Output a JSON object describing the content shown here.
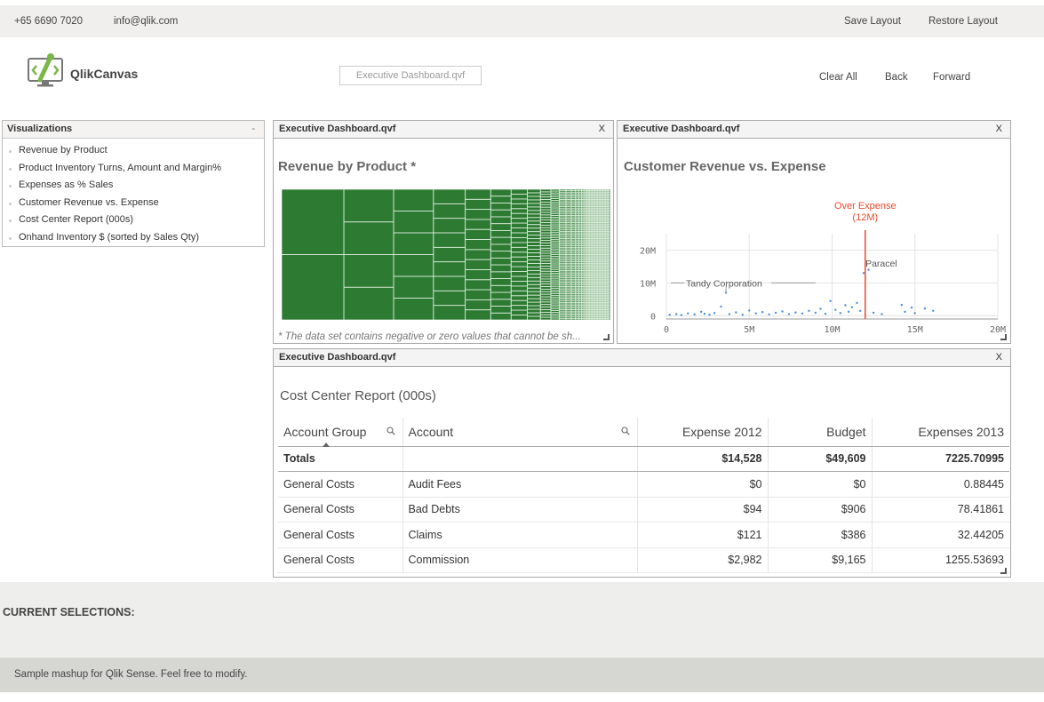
{
  "topbar": {
    "phone": "+65 6690 7020",
    "email": "info@qlik.com",
    "save_layout": "Save Layout",
    "restore_layout": "Restore Layout"
  },
  "brand": {
    "name": "QlikCanvas",
    "accent": "#7ab648"
  },
  "document_field": {
    "value": "Executive Dashboard.qvf"
  },
  "nav": {
    "clear_all": "Clear All",
    "back": "Back",
    "forward": "Forward"
  },
  "visualizations": {
    "title": "Visualizations",
    "collapse": "-",
    "items": [
      "Revenue by Product",
      "Product Inventory Turns, Amount and Margin%",
      "Expenses as % Sales",
      "Customer Revenue vs. Expense",
      "Cost Center Report (000s)",
      "Onhand Inventory $ (sorted by Sales Qty)"
    ]
  },
  "panels": {
    "revenue": {
      "header": "Executive Dashboard.qvf",
      "close": "X",
      "title": "Revenue by Product *",
      "footnote": "* The data set contains negative or zero values that cannot be sh...",
      "treemap_color": "#2d7a32"
    },
    "customer": {
      "header": "Executive Dashboard.qvf",
      "close": "X",
      "title": "Customer Revenue vs. Expense",
      "ref_line_label_1": "Over Expense",
      "ref_line_label_2": "(12M)",
      "annotation_tandy": "Tandy Corporation",
      "annotation_paracel": "Paracel",
      "ref_color": "#e8492b",
      "point_color": "#4a90d9"
    },
    "cost": {
      "header": "Executive Dashboard.qvf",
      "close": "X",
      "title": "Cost Center Report (000s)",
      "columns": [
        "Account Group",
        "Account",
        "Expense 2012",
        "Budget",
        "Expenses 2013"
      ],
      "totals": {
        "label": "Totals",
        "expense2012": "$14,528",
        "budget": "$49,609",
        "expenses2013": "7225.70995"
      },
      "rows": [
        {
          "group": "General Costs",
          "account": "Audit Fees",
          "expense2012": "$0",
          "budget": "$0",
          "expenses2013": "0.88445"
        },
        {
          "group": "General Costs",
          "account": "Bad Debts",
          "expense2012": "$94",
          "budget": "$906",
          "expenses2013": "78.41861"
        },
        {
          "group": "General Costs",
          "account": "Claims",
          "expense2012": "$121",
          "budget": "$386",
          "expenses2013": "32.44205"
        },
        {
          "group": "General Costs",
          "account": "Commission",
          "expense2012": "$2,982",
          "budget": "$9,165",
          "expenses2013": "1255.53693"
        }
      ]
    }
  },
  "chart_data": [
    {
      "type": "scatter",
      "title": "Customer Revenue vs. Expense",
      "xlim": [
        0,
        20000000
      ],
      "ylim": [
        -1000000,
        25000000
      ],
      "x_ticks": [
        "0",
        "5M",
        "10M",
        "15M",
        "20M"
      ],
      "y_ticks": [
        "20M",
        "10M",
        "0"
      ],
      "reference_line": {
        "x": 12000000,
        "label": "Over Expense (12M)"
      },
      "annotations": [
        {
          "label": "Tandy Corporation",
          "x": 3600000,
          "y": 10000000
        },
        {
          "label": "Paracel",
          "x": 11800000,
          "y": 15000000
        }
      ],
      "points": [
        [
          200000,
          300000
        ],
        [
          600000,
          500000
        ],
        [
          900000,
          200000
        ],
        [
          1300000,
          700000
        ],
        [
          1700000,
          400000
        ],
        [
          2100000,
          1200000
        ],
        [
          2300000,
          600000
        ],
        [
          2600000,
          300000
        ],
        [
          2900000,
          800000
        ],
        [
          3300000,
          2800000
        ],
        [
          3600000,
          7000000
        ],
        [
          3800000,
          500000
        ],
        [
          4200000,
          1000000
        ],
        [
          4600000,
          300000
        ],
        [
          5000000,
          1600000
        ],
        [
          5400000,
          700000
        ],
        [
          5800000,
          1100000
        ],
        [
          6200000,
          400000
        ],
        [
          6600000,
          900000
        ],
        [
          7000000,
          1300000
        ],
        [
          7400000,
          500000
        ],
        [
          7800000,
          1000000
        ],
        [
          8200000,
          700000
        ],
        [
          8600000,
          1500000
        ],
        [
          9000000,
          900000
        ],
        [
          9300000,
          2100000
        ],
        [
          9600000,
          600000
        ],
        [
          9900000,
          4500000
        ],
        [
          10200000,
          1800000
        ],
        [
          10500000,
          800000
        ],
        [
          10800000,
          3200000
        ],
        [
          11000000,
          1200000
        ],
        [
          11200000,
          2600000
        ],
        [
          11500000,
          3900000
        ],
        [
          11700000,
          1500000
        ],
        [
          11900000,
          13000000
        ],
        [
          12200000,
          14000000
        ],
        [
          12500000,
          900000
        ],
        [
          13000000,
          500000
        ],
        [
          14200000,
          3300000
        ],
        [
          14400000,
          1200000
        ],
        [
          14800000,
          2500000
        ],
        [
          15000000,
          800000
        ],
        [
          15600000,
          2200000
        ],
        [
          16100000,
          1500000
        ]
      ]
    }
  ]
}
